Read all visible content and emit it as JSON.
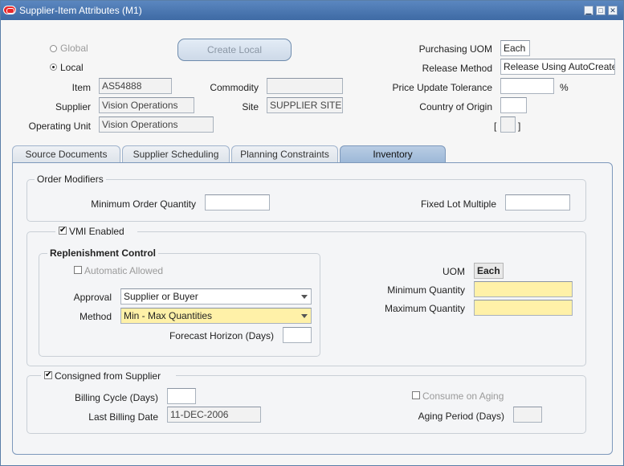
{
  "window": {
    "title": "Supplier-Item Attributes (M1)",
    "minimize": "▁",
    "maximize": "□",
    "close": "✕"
  },
  "header": {
    "global_label": "Global",
    "local_label": "Local",
    "create_local_label": "Create Local",
    "item_label": "Item",
    "item_value": "AS54888",
    "commodity_label": "Commodity",
    "commodity_value": "",
    "supplier_label": "Supplier",
    "supplier_value": "Vision Operations",
    "site_label": "Site",
    "site_value": "SUPPLIER SITE",
    "operating_unit_label": "Operating Unit",
    "operating_unit_value": "Vision Operations",
    "purchasing_uom_label": "Purchasing UOM",
    "purchasing_uom_value": "Each",
    "release_method_label": "Release Method",
    "release_method_value": "Release Using AutoCreate",
    "price_update_tolerance_label": "Price Update Tolerance",
    "price_update_tolerance_value": "",
    "percent": "%",
    "country_of_origin_label": "Country of Origin",
    "country_of_origin_value": "",
    "bracket_open": "[",
    "bracket_close": "]"
  },
  "tabs": [
    {
      "label": "Source Documents"
    },
    {
      "label": "Supplier Scheduling"
    },
    {
      "label": "Planning Constraints"
    },
    {
      "label": "Inventory"
    }
  ],
  "inventory": {
    "order_modifiers": {
      "title": "Order Modifiers",
      "min_order_qty_label": "Minimum Order Quantity",
      "min_order_qty_value": "",
      "fixed_lot_multiple_label": "Fixed Lot Multiple",
      "fixed_lot_multiple_value": ""
    },
    "vmi": {
      "enabled_label": "VMI Enabled",
      "enabled_check": "✔",
      "replenishment_title": "Replenishment Control",
      "automatic_allowed_label": "Automatic Allowed",
      "approval_label": "Approval",
      "approval_value": "Supplier or Buyer",
      "method_label": "Method",
      "method_value": "Min - Max Quantities",
      "forecast_horizon_label": "Forecast Horizon (Days)",
      "forecast_horizon_value": "",
      "uom_label": "UOM",
      "uom_value": "Each",
      "min_qty_label": "Minimum Quantity",
      "min_qty_value": "",
      "max_qty_label": "Maximum Quantity",
      "max_qty_value": ""
    },
    "consigned": {
      "label": "Consigned from Supplier",
      "check": "✔",
      "billing_cycle_label": "Billing Cycle (Days)",
      "billing_cycle_value": "",
      "last_billing_date_label": "Last Billing Date",
      "last_billing_date_value": "11-DEC-2006",
      "consume_on_aging_label": "Consume on Aging",
      "aging_period_label": "Aging Period (Days)",
      "aging_period_value": ""
    }
  }
}
